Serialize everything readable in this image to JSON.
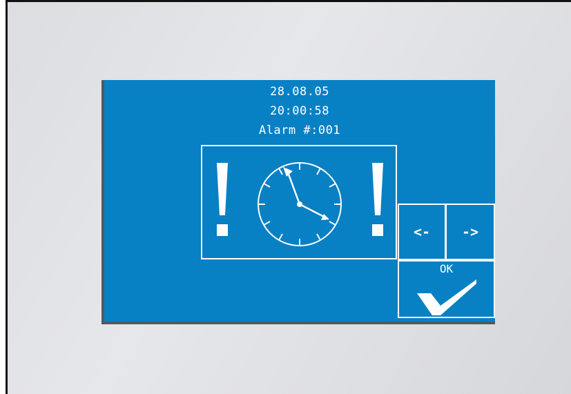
{
  "header": {
    "date": "28.08.05",
    "time": "20:00:58",
    "alarm_label": "Alarm #:001"
  },
  "icons": {
    "left_warning": "exclamation-icon",
    "clock": "clock-icon",
    "right_warning": "exclamation-icon",
    "ok_check": "checkmark-icon"
  },
  "buttons": {
    "prev_label": "<-",
    "next_label": "->",
    "ok_label": "OK"
  },
  "colors": {
    "screen": "#0880c4",
    "foreground": "#ffffff",
    "bezel": "#e2e3e6"
  }
}
